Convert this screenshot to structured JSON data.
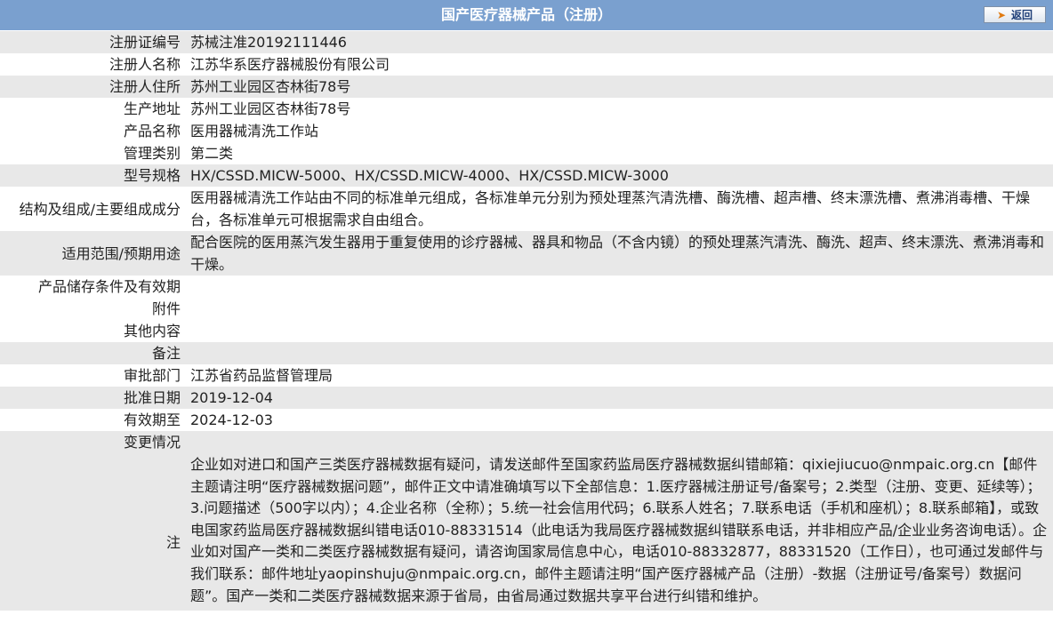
{
  "header": {
    "title": "国产医疗器械产品（注册）",
    "back_label": "返回"
  },
  "rows": [
    {
      "label": "注册证编号",
      "value": "苏械注准20192111446"
    },
    {
      "label": "注册人名称",
      "value": "江苏华系医疗器械股份有限公司"
    },
    {
      "label": "注册人住所",
      "value": "苏州工业园区杏林街78号"
    },
    {
      "label": "生产地址",
      "value": "苏州工业园区杏林街78号"
    },
    {
      "label": "产品名称",
      "value": "医用器械清洗工作站"
    },
    {
      "label": "管理类别",
      "value": "第二类"
    },
    {
      "label": "型号规格",
      "value": "HX/CSSD.MICW-5000、HX/CSSD.MICW-4000、HX/CSSD.MICW-3000"
    },
    {
      "label": "结构及组成/主要组成成分",
      "value": "医用器械清洗工作站由不同的标准单元组成，各标准单元分别为预处理蒸汽清洗槽、酶洗槽、超声槽、终末漂洗槽、煮沸消毒槽、干燥台，各标准单元可根据需求自由组合。"
    },
    {
      "label": "适用范围/预期用途",
      "value": "配合医院的医用蒸汽发生器用于重复使用的诊疗器械、器具和物品（不含内镜）的预处理蒸汽清洗、酶洗、超声、终末漂洗、煮沸消毒和干燥。"
    },
    {
      "label": "产品储存条件及有效期",
      "value": ""
    },
    {
      "label": "附件",
      "value": ""
    },
    {
      "label": "其他内容",
      "value": ""
    },
    {
      "label": "备注",
      "value": ""
    },
    {
      "label": "审批部门",
      "value": "江苏省药品监督管理局"
    },
    {
      "label": "批准日期",
      "value": "2019-12-04"
    },
    {
      "label": "有效期至",
      "value": "2024-12-03"
    },
    {
      "label": "变更情况",
      "value": ""
    },
    {
      "label": "注",
      "value": "企业如对进口和国产三类医疗器械数据有疑问，请发送邮件至国家药监局医疗器械数据纠错邮箱：qixiejiucuo@nmpaic.org.cn【邮件主题请注明“医疗器械数据问题”，邮件正文中请准确填写以下全部信息：1.医疗器械注册证号/备案号；2.类型（注册、变更、延续等）；3.问题描述（500字以内）；4.企业名称（全称）；5.统一社会信用代码；6.联系人姓名；7.联系电话（手机和座机）；8.联系邮箱】，或致电国家药监局医疗器械数据纠错电话010-88331514（此电话为我局医疗器械数据纠错联系电话，并非相应产品/企业业务咨询电话）。企业如对国产一类和二类医疗器械数据有疑问，请咨询国家局信息中心，电话010-88332877，88331520（工作日），也可通过发邮件与我们联系：邮件地址yaopinshuju@nmpaic.org.cn，邮件主题请注明“国产医疗器械产品（注册）-数据（注册证号/备案号）数据问题”。国产一类和二类医疗器械数据来源于省局，由省局通过数据共享平台进行纠错和维护。"
    }
  ]
}
